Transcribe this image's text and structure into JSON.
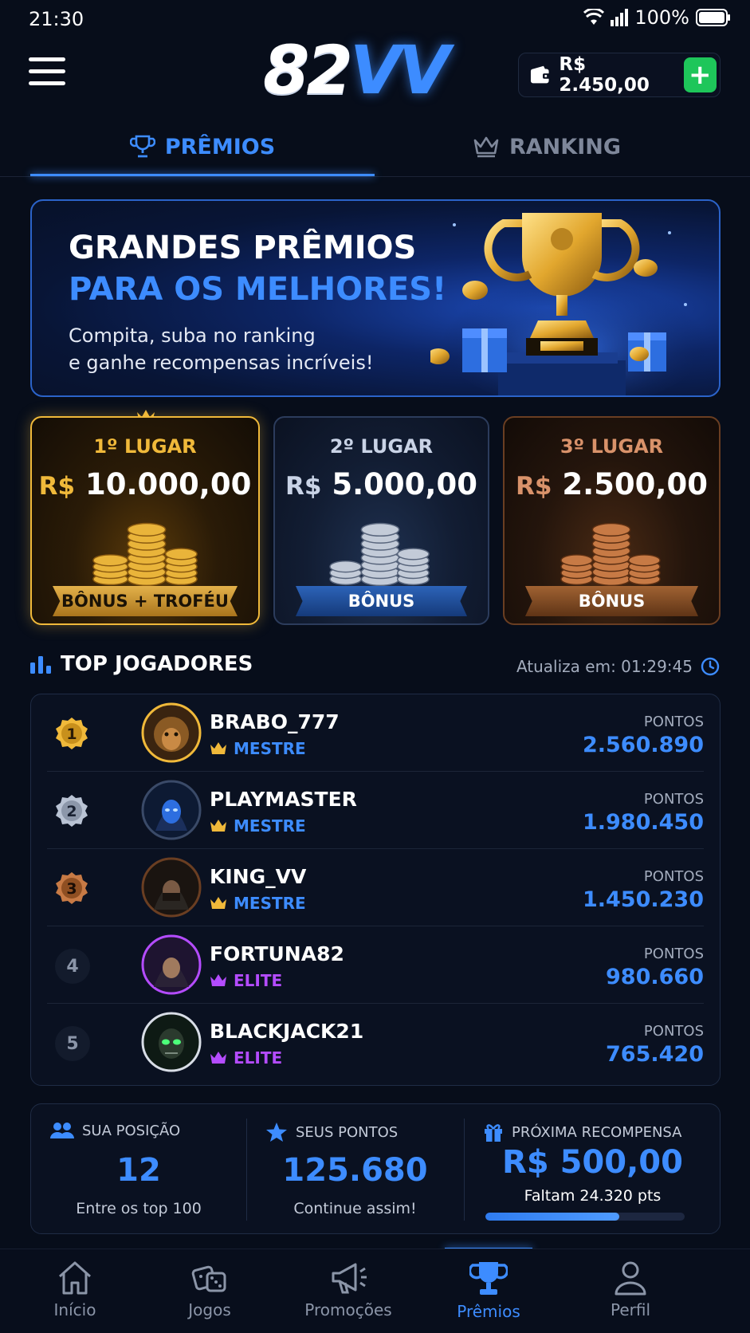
{
  "status_bar": {
    "time": "21:30",
    "battery": "100%"
  },
  "header": {
    "logo_part1": "82",
    "logo_part2": "VV",
    "wallet_balance": "R$ 2.450,00",
    "add_label": "+"
  },
  "tabs": [
    {
      "label": "PRÊMIOS",
      "active": true
    },
    {
      "label": "RANKING",
      "active": false
    }
  ],
  "banner": {
    "title_line1": "GRANDES PRÊMIOS",
    "title_line2": "PARA OS MELHORES!",
    "subtitle_line1": "Compita, suba no ranking",
    "subtitle_line2": "e ganhe recompensas incríveis!"
  },
  "prizes": [
    {
      "place": "1º LUGAR",
      "currency": "R$",
      "amount": "10.000,00",
      "reward": "BÔNUS + TROFÉU",
      "color": "#f0b93a"
    },
    {
      "place": "2º LUGAR",
      "currency": "R$",
      "amount": "5.000,00",
      "reward": "BÔNUS",
      "color": "#c9d3e6"
    },
    {
      "place": "3º LUGAR",
      "currency": "R$",
      "amount": "2.500,00",
      "reward": "BÔNUS",
      "color": "#d9926a"
    }
  ],
  "top_players": {
    "title": "TOP JOGADORES",
    "update_label": "Atualiza em: 01:29:45",
    "points_label": "PONTOS",
    "players": [
      {
        "rank": "1",
        "name": "BRABO_777",
        "tier": "MESTRE",
        "points": "2.560.890"
      },
      {
        "rank": "2",
        "name": "PLAYMASTER",
        "tier": "MESTRE",
        "points": "1.980.450"
      },
      {
        "rank": "3",
        "name": "KING_VV",
        "tier": "MESTRE",
        "points": "1.450.230"
      },
      {
        "rank": "4",
        "name": "FORTUNA82",
        "tier": "ELITE",
        "points": "980.660"
      },
      {
        "rank": "5",
        "name": "BLACKJACK21",
        "tier": "ELITE",
        "points": "765.420"
      }
    ]
  },
  "stats": {
    "position": {
      "label": "SUA POSIÇÃO",
      "value": "12",
      "sub": "Entre os top 100"
    },
    "points": {
      "label": "SEUS PONTOS",
      "value": "125.680",
      "sub": "Continue assim!"
    },
    "next_reward": {
      "label": "PRÓXIMA RECOMPENSA",
      "value": "R$ 500,00",
      "sub": "Faltam 24.320 pts",
      "progress": 0.67
    }
  },
  "bottom_nav": [
    {
      "label": "Início",
      "icon": "home-icon",
      "active": false
    },
    {
      "label": "Jogos",
      "icon": "dice-icon",
      "active": false
    },
    {
      "label": "Promoções",
      "icon": "megaphone-icon",
      "active": false
    },
    {
      "label": "Prêmios",
      "icon": "trophy-icon",
      "active": true
    },
    {
      "label": "Perfil",
      "icon": "user-icon",
      "active": false
    }
  ],
  "colors": {
    "accent": "#3d8cff",
    "gold": "#f0b93a",
    "elite": "#b44cff",
    "add_button": "#1ec65a",
    "background": "#070d1a"
  }
}
